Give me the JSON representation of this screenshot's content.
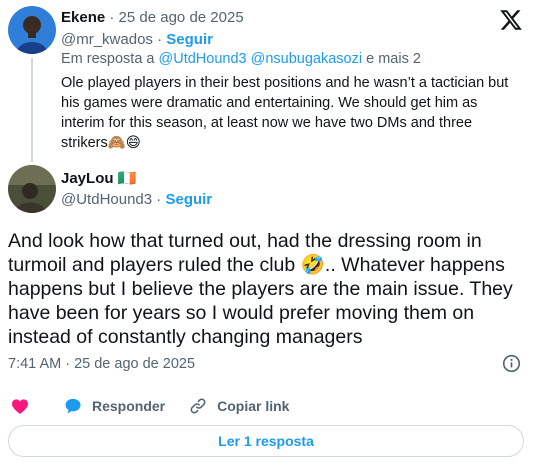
{
  "parent_tweet": {
    "author_name": "Ekene",
    "separator": " · ",
    "date": "25 de ago de 2025",
    "handle": "@mr_kwados",
    "follow_label": "Seguir",
    "reply_prefix": "Em resposta a ",
    "reply_to": "@UtdHound3 @nsubugakasozi",
    "reply_suffix": " e mais 2",
    "text": "Ole played players in their best positions and he wasn’t a tactician but his games were dramatic and entertaining. We should get him as interim for this season, at least now we have two DMs and three strikers🙈😄"
  },
  "main_tweet": {
    "author_name": "JayLou",
    "flag": "🇮🇪",
    "handle": "@UtdHound3",
    "follow_label": "Seguir",
    "text": "And look how that turned out, had the dressing room in turmoil and players ruled the club 🤣.. Whatever happens happens but I believe the players are the main issue. They have been for years so I would prefer moving them on instead of constantly changing managers",
    "timestamp": "7:41 AM · 25 de ago de 2025"
  },
  "actions": {
    "like_icon": "heart-icon",
    "reply_label": "Responder",
    "copy_link_label": "Copiar link"
  },
  "more_replies_label": "Ler 1 resposta",
  "colors": {
    "accent": "#1d9bf0",
    "text": "#0f1419",
    "muted": "#536471",
    "like": "#f91880",
    "border": "#cfd9de"
  }
}
